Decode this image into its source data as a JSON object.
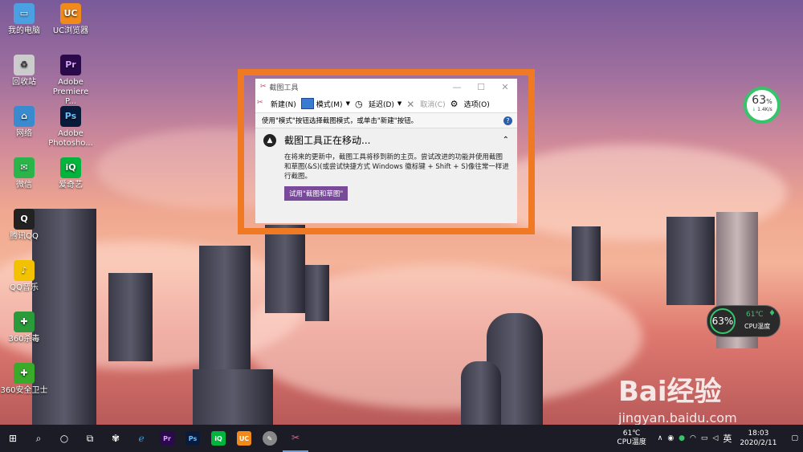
{
  "desktop_icons": [
    {
      "label": "我的电脑",
      "color": "#4aa0e0",
      "glyph": "▭",
      "icon": "computer-icon"
    },
    {
      "label": "回收站",
      "color": "#cccccc",
      "glyph": "♻",
      "icon": "recycle-bin-icon"
    },
    {
      "label": "网络",
      "color": "#3a8ad0",
      "glyph": "⌂",
      "icon": "network-icon"
    },
    {
      "label": "微信",
      "color": "#2ab44a",
      "glyph": "✉",
      "icon": "wechat-icon"
    },
    {
      "label": "腾讯QQ",
      "color": "#222222",
      "glyph": "Q",
      "icon": "qq-icon"
    },
    {
      "label": "QQ音乐",
      "color": "#f2c200",
      "glyph": "♪",
      "icon": "qq-music-icon"
    },
    {
      "label": "360杀毒",
      "color": "#2a9a3a",
      "glyph": "✚",
      "icon": "360-antivirus-icon"
    },
    {
      "label": "360安全卫士",
      "color": "#3aaa2a",
      "glyph": "✚",
      "icon": "360-security-icon"
    },
    {
      "label": "UC浏览器",
      "color": "#f08a1a",
      "glyph": "UC",
      "icon": "uc-browser-icon"
    },
    {
      "label": "Adobe Premiere P...",
      "color": "#2a0a4a",
      "glyph": "Pr",
      "icon": "premiere-icon"
    },
    {
      "label": "Adobe Photosho...",
      "color": "#0a1a3a",
      "glyph": "Ps",
      "icon": "photoshop-icon"
    },
    {
      "label": "爱奇艺",
      "color": "#00b43c",
      "glyph": "iQ",
      "icon": "iqiyi-icon"
    }
  ],
  "snip_window": {
    "title": "截图工具",
    "toolbar": {
      "new": "新建(N)",
      "mode": "模式(M)",
      "delay": "延迟(D)",
      "cancel": "取消(C)",
      "options": "选项(O)"
    },
    "hint": "使用\"模式\"按钮选择截图模式，或单击\"新建\"按钮。",
    "notice_title": "截图工具正在移动...",
    "notice_body": "在将来的更新中，截图工具将移到新的主页。尝试改进的功能并使用截图和草图(&S)(或尝试快捷方式 Windows 徽标键 + Shift + S)像往常一样进行截图。",
    "try_button": "试用\"截图和草图\""
  },
  "net_gauge": {
    "percent": "63",
    "unit": "%",
    "speed": "1.4K/s"
  },
  "cpu_widget": {
    "percent": "63%",
    "temp": "61℃",
    "label": "CPU温度"
  },
  "watermark": {
    "brand": "Bai经验",
    "url": "jingyan.baidu.com"
  },
  "taskbar": {
    "cpu_temp": "61℃",
    "cpu_label": "CPU温度",
    "ime": "英",
    "time": "18:03",
    "date": "2020/2/11"
  },
  "colors": {
    "frame": "#f07a24",
    "try_button": "#7a4a9a",
    "taskbar": "#1c1c26"
  }
}
